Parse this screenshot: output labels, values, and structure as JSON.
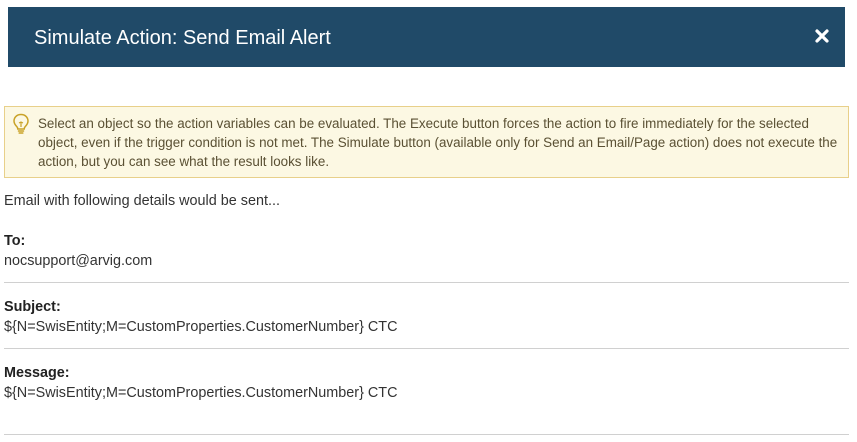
{
  "dialog": {
    "title": "Simulate Action: Send Email Alert",
    "close_icon": "close-icon"
  },
  "info": {
    "icon": "lightbulb-icon",
    "text": "Select an object so the action variables can be evaluated. The Execute button forces the action to fire immediately for the selected object, even if the trigger condition is not met. The Simulate button (available only for Send an Email/Page action) does not execute the action, but you can see what the result looks like."
  },
  "intro": "Email with following details would be sent...",
  "fields": {
    "to": {
      "label": "To:",
      "value": "nocsupport@arvig.com"
    },
    "subject": {
      "label": "Subject:",
      "value": "${N=SwisEntity;M=CustomProperties.CustomerNumber} CTC"
    },
    "message": {
      "label": "Message:",
      "value": "${N=SwisEntity;M=CustomProperties.CustomerNumber} CTC"
    }
  },
  "colors": {
    "header_bg": "#204a68",
    "info_bg": "#fcf8e3",
    "info_border": "#e8d08a"
  }
}
